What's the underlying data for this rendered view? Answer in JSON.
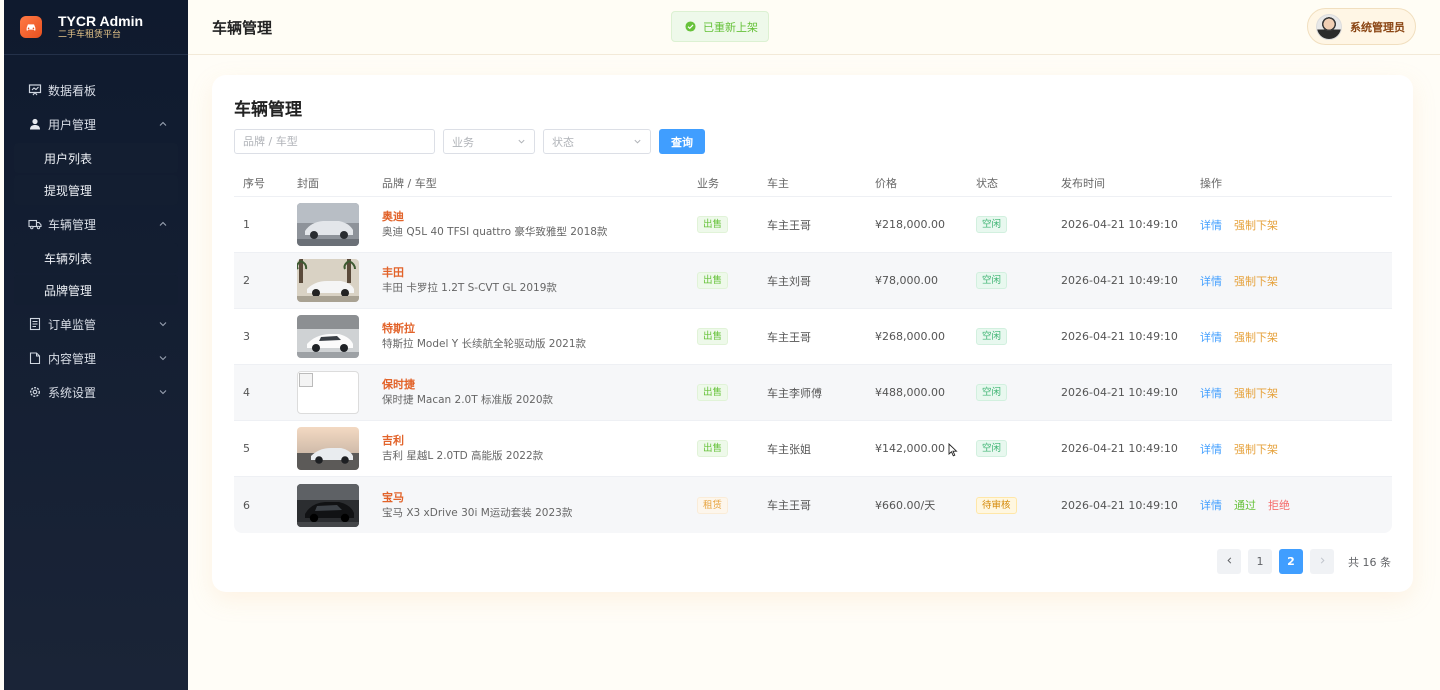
{
  "brand": {
    "title": "TYCR Admin",
    "subtitle": "二手车租赁平台"
  },
  "sidebar": {
    "items": [
      {
        "label": "数据看板",
        "icon": "chart-board-icon"
      },
      {
        "label": "用户管理",
        "icon": "user-icon",
        "expanded": true,
        "children": [
          "用户列表",
          "提现管理"
        ]
      },
      {
        "label": "车辆管理",
        "icon": "truck-icon",
        "expanded": true,
        "children": [
          "车辆列表",
          "品牌管理"
        ]
      },
      {
        "label": "订单监管",
        "icon": "document-icon"
      },
      {
        "label": "内容管理",
        "icon": "content-icon"
      },
      {
        "label": "系统设置",
        "icon": "gear-icon"
      }
    ]
  },
  "header": {
    "title": "车辆管理",
    "toast": "已重新上架",
    "user_name": "系统管理员"
  },
  "card": {
    "title": "车辆管理",
    "filters": {
      "search_placeholder": "品牌 / 车型",
      "business_placeholder": "业务",
      "status_placeholder": "状态",
      "query_label": "查询"
    },
    "columns": [
      "序号",
      "封面",
      "品牌 / 车型",
      "业务",
      "车主",
      "价格",
      "状态",
      "发布时间",
      "操作"
    ],
    "rows": [
      {
        "idx": "1",
        "brand": "奥迪",
        "model": "奥迪 Q5L 40 TFSI quattro 豪华致雅型 2018款",
        "business": "出售",
        "owner": "车主王哥",
        "price": "¥218,000.00",
        "status": "空闲",
        "time": "2026-04-21 10:49:10",
        "ops": [
          "详情",
          "强制下架"
        ]
      },
      {
        "idx": "2",
        "brand": "丰田",
        "model": "丰田 卡罗拉 1.2T S-CVT GL 2019款",
        "business": "出售",
        "owner": "车主刘哥",
        "price": "¥78,000.00",
        "status": "空闲",
        "time": "2026-04-21 10:49:10",
        "ops": [
          "详情",
          "强制下架"
        ]
      },
      {
        "idx": "3",
        "brand": "特斯拉",
        "model": "特斯拉 Model Y 长续航全轮驱动版 2021款",
        "business": "出售",
        "owner": "车主王哥",
        "price": "¥268,000.00",
        "status": "空闲",
        "time": "2026-04-21 10:49:10",
        "ops": [
          "详情",
          "强制下架"
        ]
      },
      {
        "idx": "4",
        "brand": "保时捷",
        "model": "保时捷 Macan 2.0T 标准版 2020款",
        "business": "出售",
        "owner": "车主李师傅",
        "price": "¥488,000.00",
        "status": "空闲",
        "time": "2026-04-21 10:49:10",
        "ops": [
          "详情",
          "强制下架"
        ]
      },
      {
        "idx": "5",
        "brand": "吉利",
        "model": "吉利 星越L 2.0TD 高能版 2022款",
        "business": "出售",
        "owner": "车主张姐",
        "price": "¥142,000.00",
        "status": "空闲",
        "time": "2026-04-21 10:49:10",
        "ops": [
          "详情",
          "强制下架"
        ]
      },
      {
        "idx": "6",
        "brand": "宝马",
        "model": "宝马 X3 xDrive 30i M运动套装 2023款",
        "business": "租赁",
        "owner": "车主王哥",
        "price": "¥660.00/天",
        "status": "待审核",
        "time": "2026-04-21 10:49:10",
        "ops": [
          "详情",
          "通过",
          "拒绝"
        ]
      }
    ],
    "pagination": {
      "pages": [
        "1",
        "2"
      ],
      "current": "2",
      "total": "共 16 条"
    }
  },
  "colors": {
    "primary": "#409eff",
    "accent": "#e2632a",
    "success": "#67c23a",
    "warning": "#e6a23c",
    "danger": "#f56c6c",
    "sidebar_bg": "#0f1a2e"
  }
}
